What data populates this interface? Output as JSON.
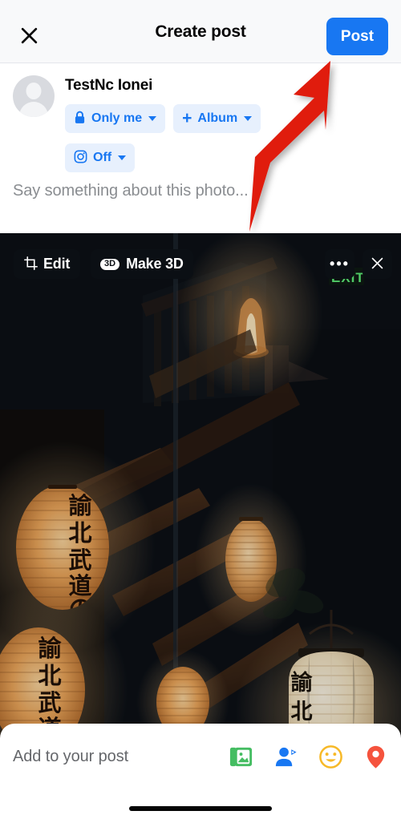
{
  "header": {
    "title": "Create post",
    "close_icon": "close-icon",
    "post_label": "Post"
  },
  "composer": {
    "author_name": "TestNc Ionei",
    "avatar_icon": "default-person-avatar",
    "caption_placeholder": "Say something about this photo...",
    "pills": [
      {
        "id": "audience",
        "icon": "lock-icon",
        "label": "Only me",
        "caret": "chevron-down-icon"
      },
      {
        "id": "album",
        "icon": "plus-icon",
        "label": "Album",
        "caret": "chevron-down-icon"
      },
      {
        "id": "instagram-share",
        "icon": "instagram-icon",
        "label": "Off",
        "caret": "chevron-down-icon"
      }
    ]
  },
  "photo": {
    "edit_label": "Edit",
    "edit_icon": "crop-icon",
    "make3d_label": "Make 3D",
    "make3d_badge": "3D",
    "more_icon": "ellipsis-icon",
    "close_icon": "close-icon",
    "alt": "Japanese paper lanterns glowing in a dark stairwell interior",
    "exit_sign_text": "EXIT"
  },
  "bottom_sheet": {
    "add_label": "Add to your post",
    "icons": [
      {
        "name": "photo-video-icon",
        "color": "#45bd62"
      },
      {
        "name": "tag-people-icon",
        "color": "#1877f2"
      },
      {
        "name": "feeling-activity-icon",
        "color": "#f7b928"
      },
      {
        "name": "check-in-location-icon",
        "color": "#f5533d"
      }
    ],
    "home_indicator": "home-indicator"
  },
  "annotation": {
    "arrow_color": "#e01b10",
    "points_to": "post-button"
  },
  "colors": {
    "accent_blue": "#1877f2",
    "pill_bg": "#e7f0fd",
    "header_bg": "#f8f9fa",
    "text_primary": "#050505",
    "text_secondary": "#65676b",
    "photo_bg": "#0a1119"
  }
}
